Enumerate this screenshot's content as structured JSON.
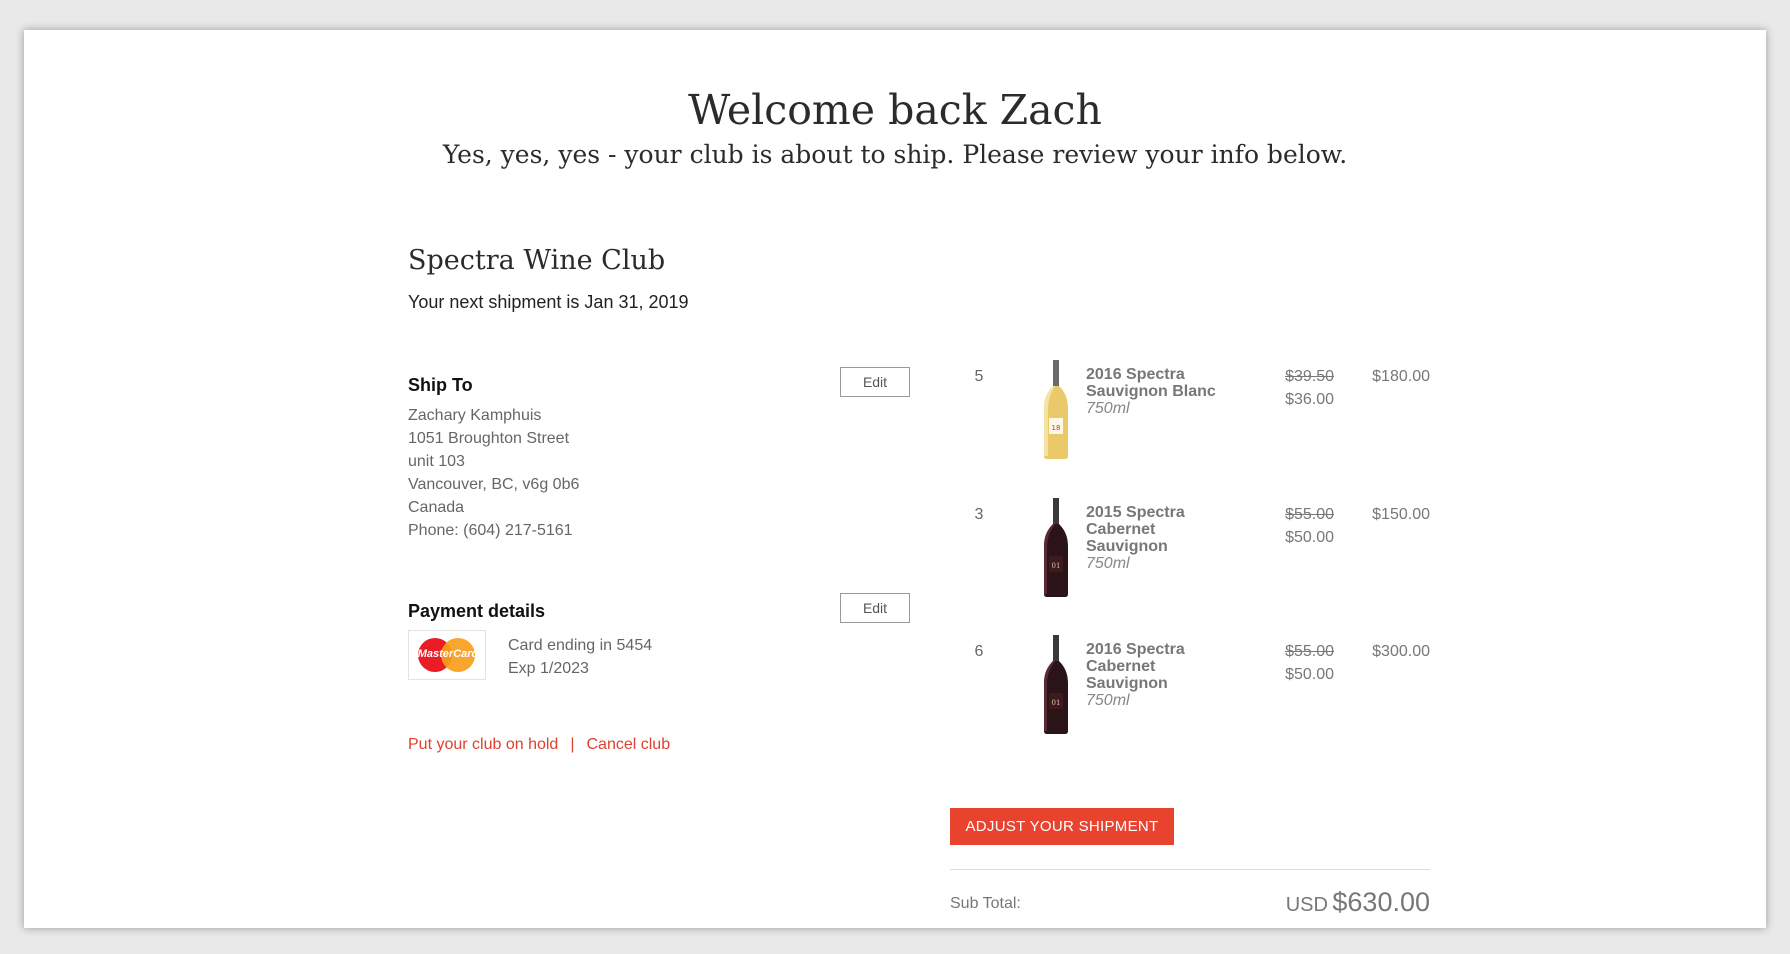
{
  "header": {
    "title": "Welcome back Zach",
    "subtitle": "Yes, yes, yes - your club is about to ship. Please review your info below."
  },
  "club": {
    "name": "Spectra Wine Club",
    "next_shipment": "Your next shipment is Jan 31, 2019"
  },
  "ship_to": {
    "heading": "Ship To",
    "edit_label": "Edit",
    "lines": [
      "Zachary Kamphuis",
      "1051 Broughton Street",
      "unit 103",
      "Vancouver, BC, v6g 0b6",
      "Canada",
      "Phone: (604) 217-5161"
    ]
  },
  "payment": {
    "heading": "Payment details",
    "edit_label": "Edit",
    "card_brand": "MasterCard",
    "card_line": "Card ending in 5454",
    "exp_line": "Exp 1/2023"
  },
  "links": {
    "hold": "Put your club on hold",
    "separator": "|",
    "cancel": "Cancel club"
  },
  "items": [
    {
      "qty": "5",
      "name": "2016 Spectra Sauvignon Blanc",
      "size": "750ml",
      "old_price": "$39.50",
      "new_price": "$36.00",
      "total": "$180.00",
      "wine_type": "white"
    },
    {
      "qty": "3",
      "name": "2015 Spectra Cabernet Sauvignon",
      "size": "750ml",
      "old_price": "$55.00",
      "new_price": "$50.00",
      "total": "$150.00",
      "wine_type": "red"
    },
    {
      "qty": "6",
      "name": "2016 Spectra Cabernet Sauvignon",
      "size": "750ml",
      "old_price": "$55.00",
      "new_price": "$50.00",
      "total": "$300.00",
      "wine_type": "red"
    }
  ],
  "adjust_button": "ADJUST YOUR SHIPMENT",
  "subtotal": {
    "label": "Sub Total:",
    "currency": "USD",
    "amount": "$630.00"
  },
  "colors": {
    "accent": "#e8432f",
    "link": "#e0402f"
  }
}
